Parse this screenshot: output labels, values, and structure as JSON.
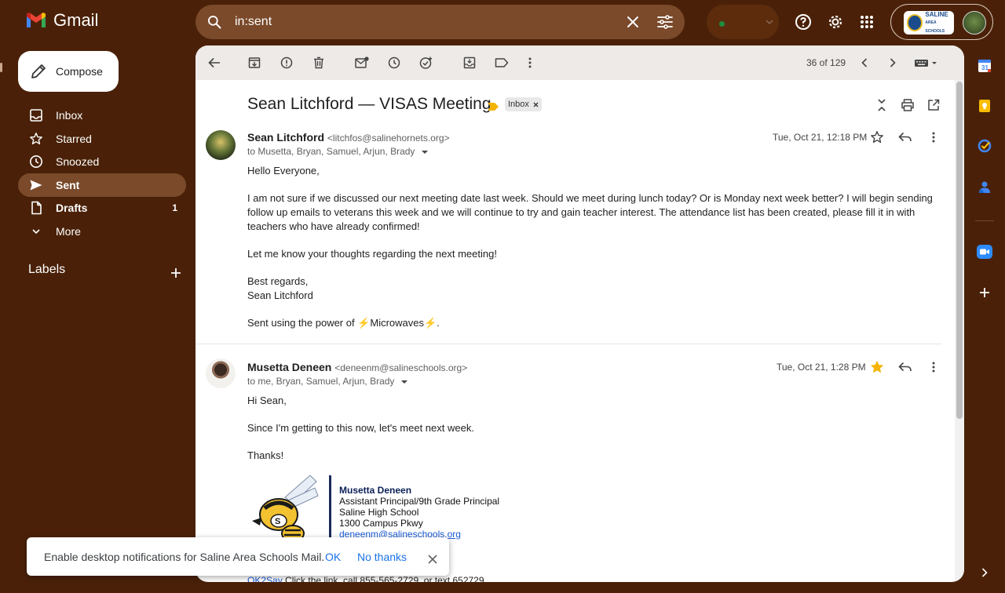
{
  "app": {
    "name": "Gmail"
  },
  "search": {
    "value": "in:sent"
  },
  "account": {
    "logo_text_1": "SALINE",
    "logo_text_2": "AREA SCHOOLS"
  },
  "compose": {
    "label": "Compose"
  },
  "sidebar": {
    "items": [
      {
        "label": "Inbox",
        "count": ""
      },
      {
        "label": "Starred",
        "count": ""
      },
      {
        "label": "Snoozed",
        "count": ""
      },
      {
        "label": "Sent",
        "count": ""
      },
      {
        "label": "Drafts",
        "count": "1"
      },
      {
        "label": "More",
        "count": ""
      }
    ],
    "labels_heading": "Labels"
  },
  "toolbar": {
    "counter": "36 of 129"
  },
  "thread": {
    "subject": "Sean Litchford — VISAS Meeting",
    "chip": "Inbox",
    "messages": [
      {
        "sender_name": "Sean Litchford",
        "sender_email": "<litchfos@salinehornets.org>",
        "to": "to Musetta, Bryan, Samuel, Arjun, Brady",
        "date": "Tue, Oct 21, 12:18 PM",
        "starred": false,
        "paragraphs": [
          "Hello Everyone,",
          "I am not sure if we discussed our next meeting date last week. Should we meet during lunch today? Or is Monday next week better? I will begin sending follow up emails to veterans this week and we will continue to try and gain teacher interest. The attendance list has been created, please fill it in with teachers who have already confirmed!",
          "Let me know your thoughts regarding the next meeting!",
          "Best regards,",
          "Sean Litchford",
          "Sent using the power of ⚡Microwaves⚡."
        ]
      },
      {
        "sender_name": "Musetta Deneen",
        "sender_email": "<deneenm@salineschools.org>",
        "to": "to me, Bryan, Samuel, Arjun, Brady",
        "date": "Tue, Oct 21, 1:28 PM",
        "starred": true,
        "paragraphs": [
          "Hi Sean,",
          "Since I'm getting to this now, let's meet next week.",
          "Thanks!"
        ],
        "signature": {
          "name": "Musetta Deneen",
          "title": "Assistant Principal/9th Grade Principal",
          "org": "Saline High School",
          "address": "1300 Campus Pkwy",
          "email": "deneenm@salineschools.org"
        },
        "footer_link": "OK2Say",
        "footer_text": " Click the link, call 855-565-2729, or text 652729"
      }
    ]
  },
  "snackbar": {
    "message": "Enable desktop notifications for Saline Area Schools Mail.",
    "ok": "OK",
    "no_thanks": "No thanks"
  },
  "colors": {
    "background": "#4a2108",
    "accent": "#1a73e8",
    "star": "#f4b400"
  },
  "icons": [
    "menu-icon",
    "search-icon",
    "clear-icon",
    "tune-icon",
    "help-icon",
    "gear-icon",
    "apps-icon",
    "pencil-icon",
    "inbox-icon",
    "star-icon",
    "clock-icon",
    "send-icon",
    "draft-icon",
    "chevron-down-icon",
    "plus-icon",
    "back-icon",
    "archive-icon",
    "report-icon",
    "trash-icon",
    "mark-unread-icon",
    "snooze-icon",
    "add-task-icon",
    "move-icon",
    "label-icon",
    "more-vert-icon",
    "chevron-left-icon",
    "chevron-right-icon",
    "keyboard-icon",
    "collapse-icon",
    "print-icon",
    "open-new-icon",
    "reply-icon",
    "calendar-icon",
    "keep-icon",
    "tasks-icon",
    "contacts-icon",
    "zoom-icon",
    "close-icon"
  ]
}
